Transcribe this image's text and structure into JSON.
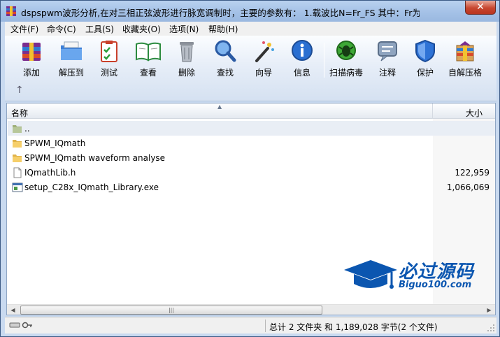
{
  "window": {
    "title": "dspspwm波形分析,在对三相正弦波形进行脉宽调制时，主要的参数有： 1.载波比N=Fr_FS 其中：Fr为载..."
  },
  "menu": {
    "items": [
      "文件(F)",
      "命令(C)",
      "工具(S)",
      "收藏夹(O)",
      "选项(N)",
      "帮助(H)"
    ]
  },
  "toolbar": {
    "buttons": [
      {
        "label": "添加",
        "icon": "add-archive-icon"
      },
      {
        "label": "解压到",
        "icon": "extract-to-icon"
      },
      {
        "label": "测试",
        "icon": "test-icon"
      },
      {
        "label": "查看",
        "icon": "view-icon"
      },
      {
        "label": "删除",
        "icon": "delete-icon"
      },
      {
        "label": "查找",
        "icon": "find-icon"
      },
      {
        "label": "向导",
        "icon": "wizard-icon"
      },
      {
        "label": "信息",
        "icon": "info-icon"
      },
      {
        "label": "扫描病毒",
        "icon": "virus-scan-icon"
      },
      {
        "label": "注释",
        "icon": "comment-icon"
      },
      {
        "label": "保护",
        "icon": "protect-icon"
      },
      {
        "label": "自解压格",
        "icon": "sfx-icon"
      }
    ]
  },
  "list": {
    "columns": {
      "name": "名称",
      "size": "大小"
    },
    "rows": [
      {
        "name": "..",
        "size": "",
        "type": "parent"
      },
      {
        "name": "SPWM_IQmath",
        "size": "",
        "type": "folder"
      },
      {
        "name": "SPWM_IQmath waveform analyse",
        "size": "",
        "type": "folder"
      },
      {
        "name": "IQmathLib.h",
        "size": "122,959",
        "type": "file"
      },
      {
        "name": "setup_C28x_IQmath_Library.exe",
        "size": "1,066,069",
        "type": "exe"
      }
    ]
  },
  "watermark": {
    "title": "必过源码",
    "subtitle": "Biguo100.com"
  },
  "status": {
    "summary": "总计 2 文件夹 和 1,189,028 字节(2 个文件)"
  },
  "colors": {
    "titlebar": "#a3c0e6",
    "close": "#c7462f",
    "watermark": "#0b56b0"
  }
}
